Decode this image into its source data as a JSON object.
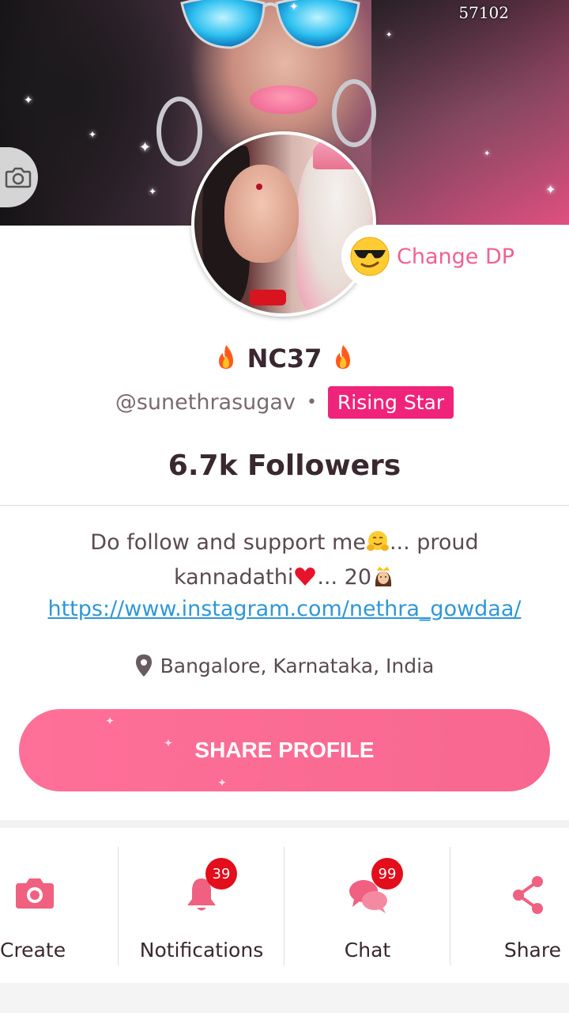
{
  "cover": {
    "view_count": "57102",
    "change_cover_icon": "camera-icon"
  },
  "profile": {
    "change_dp_label": "Change DP",
    "change_dp_icon": "sunglasses-face-emoji",
    "display_name": "NC37",
    "name_decoration_icon": "fire-emoji",
    "handle": "@sunethrasugav",
    "separator": "•",
    "badge": "Rising Star",
    "followers": "6.7k Followers"
  },
  "bio": {
    "line1_part1": "Do follow and support me",
    "line1_part2": "... proud",
    "line2_part1": "kannadathi",
    "line2_part2": "... 20",
    "link": "https://www.instagram.com/nethra_gowdaa/",
    "emojis": [
      "hugging-face-emoji",
      "red-heart-emoji",
      "princess-emoji"
    ]
  },
  "location": {
    "icon": "location-pin-icon",
    "text": "Bangalore, Karnataka, India"
  },
  "share_profile": {
    "label": "SHARE PROFILE"
  },
  "actions": [
    {
      "label": "Create",
      "icon": "camera-icon"
    },
    {
      "label": "Notifications",
      "icon": "bell-icon",
      "count": "39"
    },
    {
      "label": "Chat",
      "icon": "chat-bubbles-icon",
      "count": "99"
    },
    {
      "label": "Share",
      "icon": "share-icon"
    }
  ],
  "colors": {
    "accent_pink": "#f7678f",
    "badge_pink": "#f0237a",
    "link_blue": "#2f97d8",
    "counter_red": "#e30d1b",
    "icon_pink": "#f06080"
  }
}
